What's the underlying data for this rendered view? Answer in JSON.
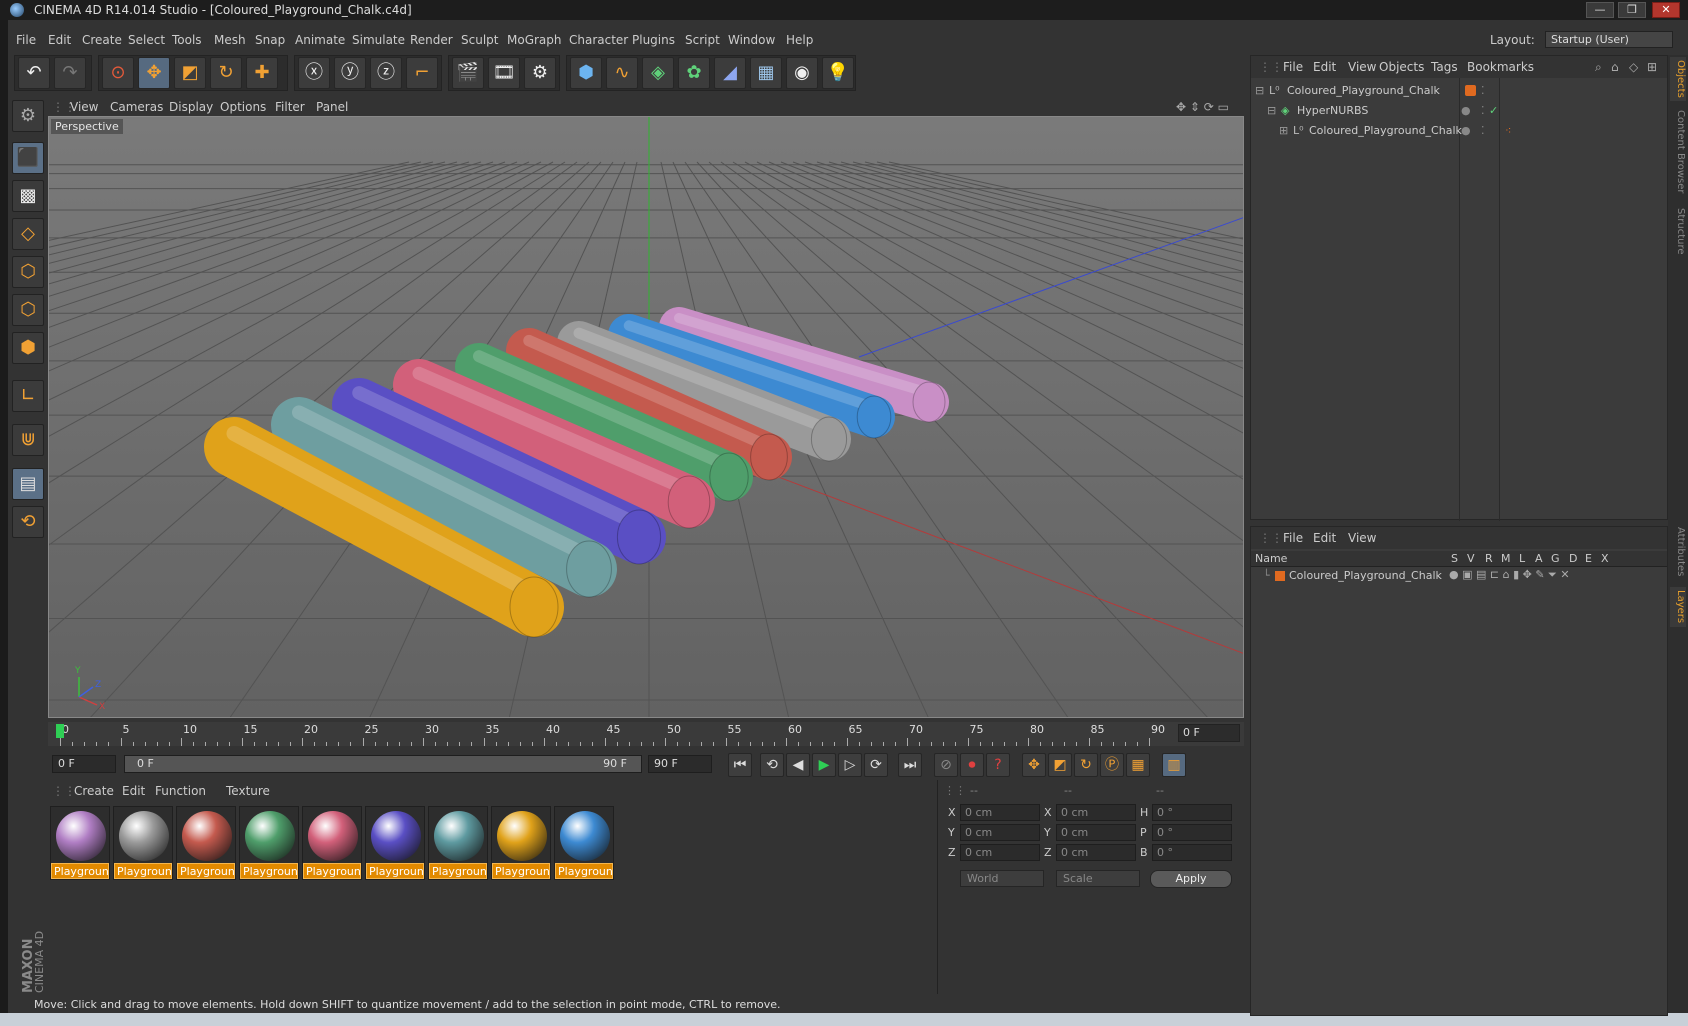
{
  "window": {
    "title": "CINEMA 4D R14.014 Studio - [Coloured_Playground_Chalk.c4d]",
    "minimize": "—",
    "restore": "❐",
    "close": "✕"
  },
  "menubar": {
    "items": [
      "File",
      "Edit",
      "Create",
      "Select",
      "Tools",
      "Mesh",
      "Snap",
      "Animate",
      "Simulate",
      "Render",
      "Sculpt",
      "MoGraph",
      "Character",
      "Plugins",
      "Script",
      "Window",
      "Help"
    ],
    "layout_label": "Layout:",
    "layout_value": "Startup (User)"
  },
  "viewport": {
    "menu": [
      "View",
      "Cameras",
      "Display",
      "Options",
      "Filter",
      "Panel"
    ],
    "label": "Perspective",
    "axis_x": "X",
    "axis_y": "Y",
    "axis_z": "Z"
  },
  "timeline": {
    "ticks": [
      "0",
      "5",
      "10",
      "15",
      "20",
      "25",
      "30",
      "35",
      "40",
      "45",
      "50",
      "55",
      "60",
      "65",
      "70",
      "75",
      "80",
      "85",
      "90"
    ],
    "current_frame": "0 F"
  },
  "transport": {
    "start_field": "0 F",
    "range_start": "0 F",
    "range_end": "90 F",
    "end_field": "90 F"
  },
  "materials": {
    "menu": [
      "Create",
      "Edit",
      "Function",
      "Texture"
    ],
    "items": [
      {
        "label": "Playground",
        "color": "#b07ec4"
      },
      {
        "label": "Playground",
        "color": "#9a9a9a"
      },
      {
        "label": "Playground",
        "color": "#c45a4e"
      },
      {
        "label": "Playground",
        "color": "#4f9e6b"
      },
      {
        "label": "Playground",
        "color": "#d2607a"
      },
      {
        "label": "Playground",
        "color": "#5a4fc4"
      },
      {
        "label": "Playground",
        "color": "#5e9aa0"
      },
      {
        "label": "Playground",
        "color": "#e0a21a"
      },
      {
        "label": "Playground",
        "color": "#3d8ad2"
      }
    ]
  },
  "coords": {
    "headers": [
      "--",
      "--",
      "--"
    ],
    "rows": [
      {
        "a": "X",
        "av": "0 cm",
        "b": "X",
        "bv": "0 cm",
        "c": "H",
        "cv": "0 °"
      },
      {
        "a": "Y",
        "av": "0 cm",
        "b": "Y",
        "bv": "0 cm",
        "c": "P",
        "cv": "0 °"
      },
      {
        "a": "Z",
        "av": "0 cm",
        "b": "Z",
        "bv": "0 cm",
        "c": "B",
        "cv": "0 °"
      }
    ],
    "mode": "World",
    "transform": "Scale",
    "apply": "Apply"
  },
  "status": "Move: Click and drag to move elements. Hold down SHIFT to quantize movement / add to the selection in point mode, CTRL to remove.",
  "objects": {
    "menu": [
      "File",
      "Edit",
      "View",
      "Objects",
      "Tags",
      "Bookmarks"
    ],
    "rows": [
      {
        "name": "Coloured_Playground_Chalk"
      },
      {
        "name": "HyperNURBS"
      },
      {
        "name": "Coloured_Playground_Chalk"
      }
    ]
  },
  "layers": {
    "menu": [
      "File",
      "Edit",
      "View"
    ],
    "headers": [
      "Name",
      "S",
      "V",
      "R",
      "M",
      "L",
      "A",
      "G",
      "D",
      "E",
      "X"
    ],
    "row": "Coloured_Playground_Chalk"
  },
  "side_tabs": [
    "Objects",
    "Content Browser",
    "Structure",
    "Attributes",
    "Layers"
  ],
  "brand": {
    "maxon": "MAXON",
    "product": "CINEMA 4D"
  },
  "chalk_colors": [
    "#e0a21a",
    "#6e9ea0",
    "#5a4fc4",
    "#d2607a",
    "#4f9e6b",
    "#c45a4e",
    "#9a9a9a",
    "#3d8ad2",
    "#c98fc6"
  ]
}
